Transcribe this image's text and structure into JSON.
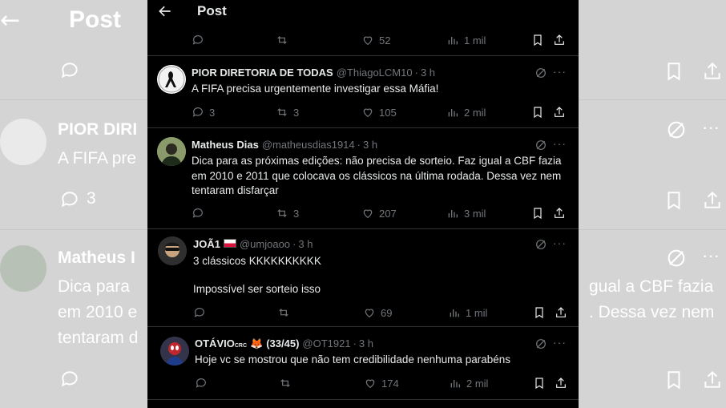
{
  "header": {
    "title": "Post"
  },
  "top_actions": {
    "likes": "52",
    "views": "1 mil"
  },
  "tweets": [
    {
      "name": "PIOR DIRETORIA DE TODAS",
      "handle": "@ThiagoLCM10",
      "time": "3 h",
      "text": [
        "A FIFA precisa urgentemente investigar essa Máfia!"
      ],
      "replies": "3",
      "retweets": "3",
      "likes": "105",
      "views": "2 mil"
    },
    {
      "name": "Matheus Dias",
      "handle": "@matheusdias1914",
      "time": "3 h",
      "text": [
        "Dica para as próximas edições: não precisa de sorteio. Faz igual a CBF fazia",
        "em 2010 e 2011 que colocava os clássicos na última rodada. Dessa vez nem",
        "tentaram disfarçar"
      ],
      "replies": "",
      "retweets": "3",
      "likes": "207",
      "views": "3 mil"
    },
    {
      "name": "JOÃ1",
      "handle": "@umjoaoo",
      "time": "3 h",
      "text": [
        "3 clássicos KKKKKKKKKK",
        "",
        "Impossível ser sorteio isso"
      ],
      "replies": "",
      "retweets": "",
      "likes": "69",
      "views": "1 mil"
    },
    {
      "name": "OTÁVIO",
      "name_sup": "CRC",
      "name_suffix": "(33/45)",
      "handle": "@OT1921",
      "time": "3 h",
      "text": [
        "Hoje vc se mostrou que não tem credibilidade nenhuma parabéns"
      ],
      "replies": "",
      "retweets": "",
      "likes": "174",
      "views": "2 mil"
    }
  ],
  "background": {
    "title": "Post",
    "name1": "PIOR DIRI",
    "text1": "A FIFA pre",
    "replies1": "3",
    "name2": "Matheus I",
    "text2a": "Dica para",
    "text2b": "em 2010 e",
    "text2c": "tentaram d",
    "text2r1": "gual a CBF fazia",
    "text2r2": ". Dessa vez nem"
  },
  "icons": {
    "back": "back-arrow-icon",
    "reply": "reply-icon",
    "retweet": "retweet-icon",
    "like": "heart-icon",
    "views": "bar-chart-icon",
    "bookmark": "bookmark-icon",
    "share": "share-icon",
    "grok": "grok-icon",
    "more": "more-icon"
  },
  "colors": {
    "panel": "#000000",
    "text": "#e7e9ea",
    "muted": "#71767b",
    "divider": "#2f3336"
  }
}
